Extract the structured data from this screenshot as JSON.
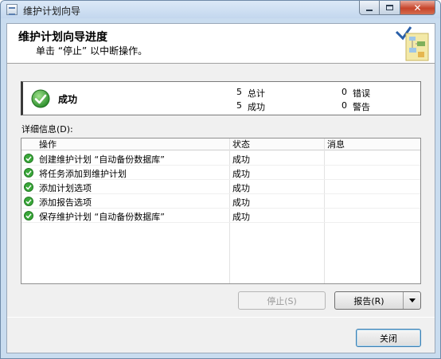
{
  "window": {
    "title": "维护计划向导"
  },
  "header": {
    "title": "维护计划向导进度",
    "subtitle": "单击 “停止” 以中断操作。"
  },
  "summary": {
    "status": "成功",
    "total_count": "5",
    "total_label": "总计",
    "success_count": "5",
    "success_label": "成功",
    "error_count": "0",
    "error_label": "错误",
    "warning_count": "0",
    "warning_label": "警告"
  },
  "details": {
    "label": "详细信息(D):",
    "columns": [
      "操作",
      "状态",
      "消息"
    ],
    "rows": [
      {
        "action": "创建维护计划 “自动备份数据库”",
        "status": "成功",
        "message": ""
      },
      {
        "action": "将任务添加到维护计划",
        "status": "成功",
        "message": ""
      },
      {
        "action": "添加计划选项",
        "status": "成功",
        "message": ""
      },
      {
        "action": "添加报告选项",
        "status": "成功",
        "message": ""
      },
      {
        "action": "保存维护计划 “自动备份数据库”",
        "status": "成功",
        "message": ""
      }
    ]
  },
  "buttons": {
    "stop": "停止(S)",
    "report": "报告(R)",
    "close": "关闭"
  },
  "colors": {
    "success_green": "#3aa83a",
    "title_bar": "#c9dcef",
    "close_red": "#c7442b"
  },
  "icons": {
    "success": "check-circle-icon",
    "header_art": "wizard-illustration-icon",
    "dropdown": "chevron-down-icon"
  }
}
